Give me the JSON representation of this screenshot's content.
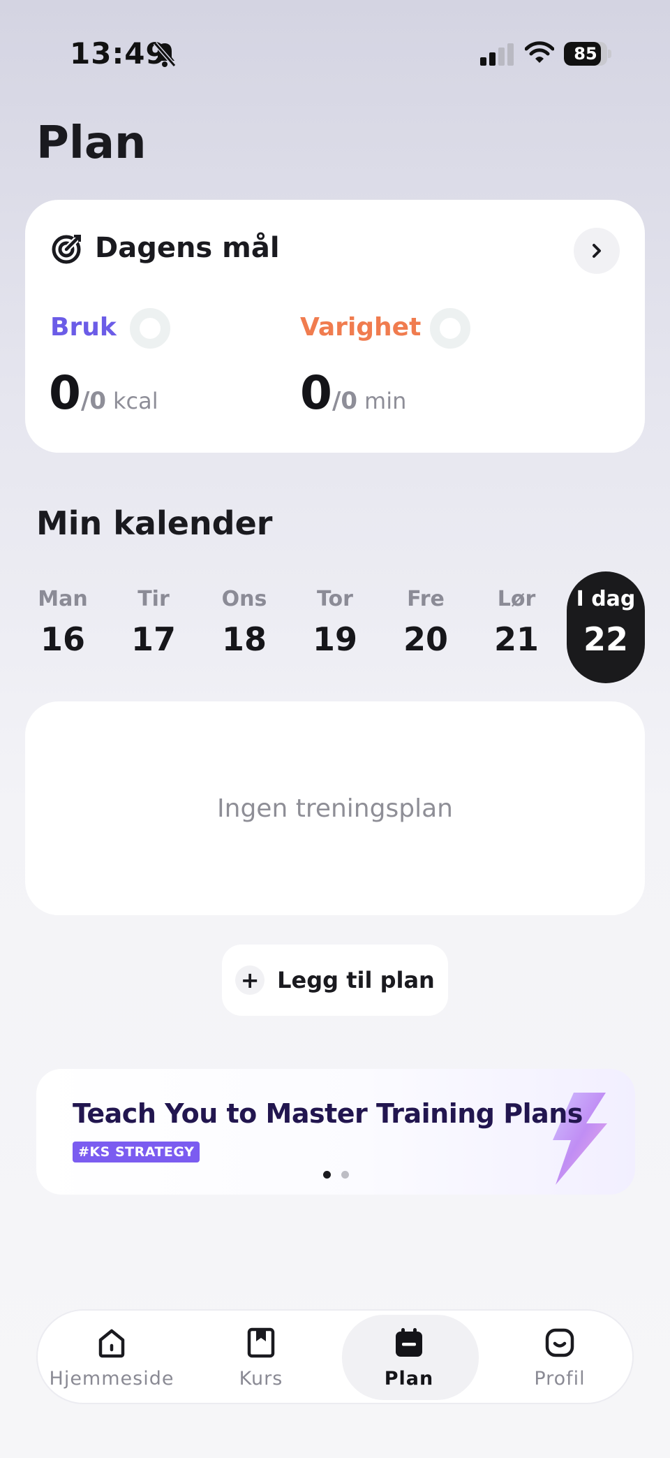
{
  "status_bar": {
    "time": "13:49",
    "battery": "85",
    "battery_level": 0.85
  },
  "page": {
    "title": "Plan"
  },
  "goals": {
    "title": "Dagens mål",
    "burn": {
      "label": "Bruk",
      "value": "0",
      "goal": "/0",
      "unit": "kcal",
      "color": "#6b5ce7"
    },
    "duration": {
      "label": "Varighet",
      "value": "0",
      "goal": "/0",
      "unit": "min",
      "color": "#f07c4f"
    }
  },
  "calendar": {
    "title": "Min kalender",
    "days": [
      {
        "name": "Man",
        "num": "16"
      },
      {
        "name": "Tir",
        "num": "17"
      },
      {
        "name": "Ons",
        "num": "18"
      },
      {
        "name": "Tor",
        "num": "19"
      },
      {
        "name": "Fre",
        "num": "20"
      },
      {
        "name": "Lør",
        "num": "21"
      },
      {
        "name": "I dag",
        "num": "22",
        "selected": true
      }
    ]
  },
  "plan": {
    "empty_text": "Ingen treningsplan",
    "add_label": "Legg til plan"
  },
  "banner": {
    "title": "Teach You to Master Training Plans",
    "tag": "#KS STRATEGY",
    "page_count": 2,
    "active_page": 1
  },
  "tabs": [
    {
      "label": "Hjemmeside",
      "icon": "home-icon"
    },
    {
      "label": "Kurs",
      "icon": "bookmark-book-icon"
    },
    {
      "label": "Plan",
      "icon": "calendar-icon",
      "active": true
    },
    {
      "label": "Profil",
      "icon": "profile-face-icon"
    }
  ]
}
